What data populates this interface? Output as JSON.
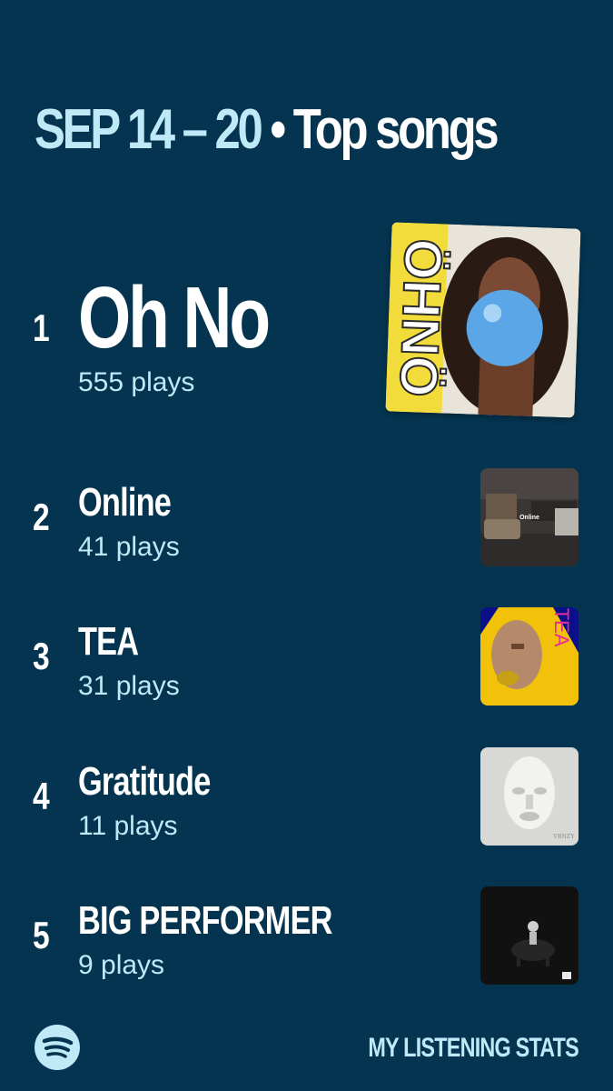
{
  "header": {
    "date_range": "SEP 14 – 20",
    "separator": "•",
    "title": "Top songs"
  },
  "songs": [
    {
      "rank": "1",
      "name": "Oh No",
      "plays": "555 plays"
    },
    {
      "rank": "2",
      "name": "Online",
      "plays": "41 plays"
    },
    {
      "rank": "3",
      "name": "TEA",
      "plays": "31 plays"
    },
    {
      "rank": "4",
      "name": "Gratitude",
      "plays": "11 plays"
    },
    {
      "rank": "5",
      "name": "BIG PERFORMER",
      "plays": "9 plays"
    }
  ],
  "covers": {
    "cover1_text": "ÖHNÖ",
    "cover2_text": "Online",
    "cover3_text": "TEA",
    "cover4_text": "VRNZY"
  },
  "footer": {
    "logo_icon": "spotify-logo-icon",
    "label": "MY LISTENING STATS"
  },
  "colors": {
    "background": "#04344f",
    "accent": "#bfe9f7",
    "text": "#ffffff"
  }
}
